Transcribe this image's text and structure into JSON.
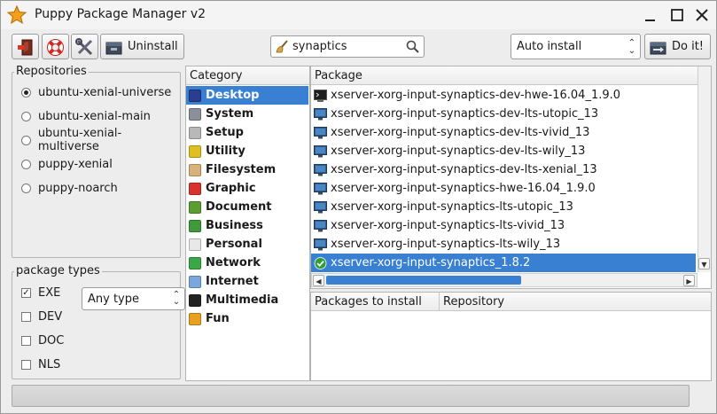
{
  "window": {
    "title": "Puppy Package Manager v2"
  },
  "toolbar": {
    "uninstall_label": "Uninstall",
    "search_value": "synaptics",
    "install_mode": "Auto install",
    "doit_label": "Do it!"
  },
  "repositories": {
    "legend": "Repositories",
    "items": [
      {
        "label": "ubuntu-xenial-universe",
        "selected": true
      },
      {
        "label": "ubuntu-xenial-main",
        "selected": false
      },
      {
        "label": "ubuntu-xenial-multiverse",
        "selected": false
      },
      {
        "label": "puppy-xenial",
        "selected": false
      },
      {
        "label": "puppy-noarch",
        "selected": false
      }
    ]
  },
  "package_types": {
    "legend": "package types",
    "type_select": "Any type",
    "items": [
      {
        "label": "EXE",
        "checked": true
      },
      {
        "label": "DEV",
        "checked": false
      },
      {
        "label": "DOC",
        "checked": false
      },
      {
        "label": "NLS",
        "checked": false
      }
    ]
  },
  "categories": {
    "header": "Category",
    "items": [
      {
        "label": "Desktop",
        "icon": "desktop-icon",
        "color": "#2a3d8f",
        "selected": true
      },
      {
        "label": "System",
        "icon": "system-icon",
        "color": "#8a9099"
      },
      {
        "label": "Setup",
        "icon": "setup-icon",
        "color": "#b8b8b8"
      },
      {
        "label": "Utility",
        "icon": "utility-icon",
        "color": "#e0c020"
      },
      {
        "label": "Filesystem",
        "icon": "filesystem-icon",
        "color": "#d9b27a"
      },
      {
        "label": "Graphic",
        "icon": "graphic-icon",
        "color": "#d9332b"
      },
      {
        "label": "Document",
        "icon": "document-icon",
        "color": "#5a9e2f"
      },
      {
        "label": "Business",
        "icon": "business-icon",
        "color": "#3f9b3a"
      },
      {
        "label": "Personal",
        "icon": "personal-icon",
        "color": "#e8e8e8"
      },
      {
        "label": "Network",
        "icon": "network-icon",
        "color": "#3aa845"
      },
      {
        "label": "Internet",
        "icon": "internet-icon",
        "color": "#7aa7de"
      },
      {
        "label": "Multimedia",
        "icon": "multimedia-icon",
        "color": "#222222"
      },
      {
        "label": "Fun",
        "icon": "fun-icon",
        "color": "#e8a020"
      }
    ]
  },
  "packages": {
    "header": "Package",
    "items": [
      {
        "label": "xserver-xorg-input-synaptics-dev-hwe-16.04_1.9.0",
        "icon": "terminal-icon"
      },
      {
        "label": "xserver-xorg-input-synaptics-dev-lts-utopic_13",
        "icon": "monitor-icon"
      },
      {
        "label": "xserver-xorg-input-synaptics-dev-lts-vivid_13",
        "icon": "monitor-icon"
      },
      {
        "label": "xserver-xorg-input-synaptics-dev-lts-wily_13",
        "icon": "monitor-icon"
      },
      {
        "label": "xserver-xorg-input-synaptics-dev-lts-xenial_13",
        "icon": "monitor-icon"
      },
      {
        "label": "xserver-xorg-input-synaptics-hwe-16.04_1.9.0",
        "icon": "monitor-icon"
      },
      {
        "label": "xserver-xorg-input-synaptics-lts-utopic_13",
        "icon": "monitor-icon"
      },
      {
        "label": "xserver-xorg-input-synaptics-lts-vivid_13",
        "icon": "monitor-icon"
      },
      {
        "label": "xserver-xorg-input-synaptics-lts-wily_13",
        "icon": "monitor-icon"
      },
      {
        "label": "xserver-xorg-input-synaptics_1.8.2",
        "icon": "installed-check-icon",
        "selected": true
      }
    ]
  },
  "install_list": {
    "col_packages": "Packages to install",
    "col_repository": "Repository"
  },
  "colors": {
    "selection": "#3a80d2",
    "window_bg": "#ededed"
  }
}
